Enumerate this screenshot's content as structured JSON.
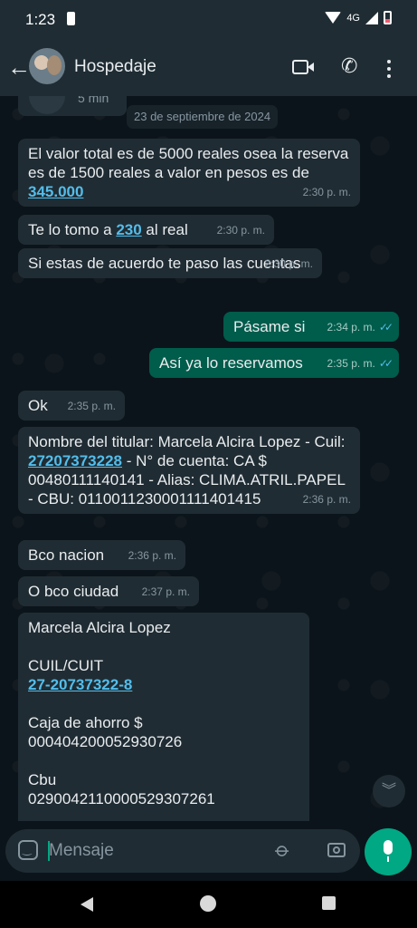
{
  "status_bar": {
    "time": "1:23",
    "network": "4G"
  },
  "header": {
    "contact_name": "Hospedaje"
  },
  "chat": {
    "partial_top_label": "5 min",
    "date_chip": "23 de septiembre de 2024",
    "messages": [
      {
        "dir": "in",
        "pre": "El valor total es de 5000 reales osea la reserva es de 1500 reales a valor en pesos es de ",
        "link": "345.000",
        "post": "",
        "time": "2:30 p. m."
      },
      {
        "dir": "in",
        "pre": "Te lo tomo a ",
        "link": "230",
        "post": " al real",
        "time": "2:30 p. m."
      },
      {
        "dir": "in",
        "pre": "Si estas de acuerdo te paso las cuentas",
        "link": "",
        "post": "",
        "time": "2:30 p. m."
      },
      {
        "dir": "out",
        "pre": "Pásame si",
        "link": "",
        "post": "",
        "time": "2:34 p. m."
      },
      {
        "dir": "out",
        "pre": "Así ya lo reservamos",
        "link": "",
        "post": "",
        "time": "2:35 p. m."
      },
      {
        "dir": "in",
        "pre": "Ok",
        "link": "",
        "post": "",
        "time": "2:35 p. m."
      },
      {
        "dir": "in",
        "pre": "Nombre del titular: Marcela Alcira Lopez - Cuil: ",
        "link": "27207373228",
        "post": " - N° de cuenta: CA $ 00480111140141 - Alias: CLIMA.ATRIL.PAPEL - CBU: 0110011230001111401415",
        "time": "2:36 p. m."
      },
      {
        "dir": "in",
        "pre": "Bco nacion",
        "link": "",
        "post": "",
        "time": "2:36 p. m."
      },
      {
        "dir": "in",
        "pre": "O bco ciudad",
        "link": "",
        "post": "",
        "time": "2:37 p. m."
      },
      {
        "dir": "in",
        "pre": "Marcela Alcira Lopez\n\nCUIL/CUIT\n",
        "link": "27-20737322-8",
        "post": "\n\nCaja de ahorro $\n000404200052930726\n\nCbu\n0290042110000529307261",
        "time": ""
      }
    ]
  },
  "composer": {
    "placeholder": "Mensaje"
  },
  "icons": {
    "back": "arrow-left-icon",
    "video": "video-call-icon",
    "call": "phone-icon",
    "menu": "more-vert-icon",
    "emoji": "sticker-icon",
    "attach": "paperclip-icon",
    "camera": "camera-icon",
    "mic": "mic-icon",
    "scroll": "double-chevron-down-icon",
    "read": "double-check-icon"
  },
  "colors": {
    "incoming_bubble": "#202c33",
    "outgoing_bubble": "#005c4b",
    "link": "#53bdeb",
    "accent": "#00a884"
  }
}
